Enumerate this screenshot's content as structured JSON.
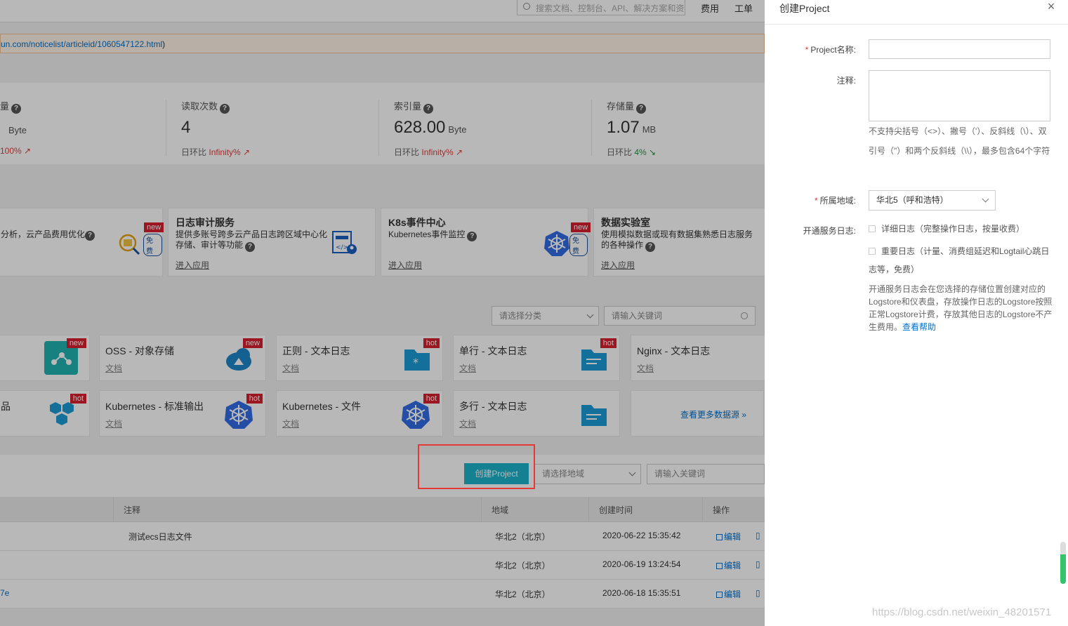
{
  "topbar": {
    "search_placeholder": "搜索文档、控制台、API、解决方案和资",
    "links": [
      "费用",
      "工单"
    ]
  },
  "notice": {
    "url_text": "un.com/noticelist/articleid/1060547122.html",
    "paren": ")"
  },
  "stats": [
    {
      "label": "量",
      "value": "",
      "unit": "Byte",
      "ratio_label": "",
      "ratio": "100%",
      "trend": "up"
    },
    {
      "label": "读取次数",
      "value": "4",
      "unit": "",
      "ratio_label": "日环比",
      "ratio": "Infinity%",
      "trend": "up"
    },
    {
      "label": "索引量",
      "value": "628.00",
      "unit": "Byte",
      "ratio_label": "日环比",
      "ratio": "Infinity%",
      "trend": "up"
    },
    {
      "label": "存储量",
      "value": "1.07",
      "unit": "MB",
      "ratio_label": "日环比",
      "ratio": "4%",
      "trend": "down"
    }
  ],
  "services": [
    {
      "title": "",
      "desc1": "分析，云产品费用优化",
      "desc2": "",
      "link": "",
      "badge": "new",
      "badge2": "免费"
    },
    {
      "title": "日志审计服务",
      "desc1": "提供多账号跨多云产品日志跨区域中心化",
      "desc2": "存储、审计等功能",
      "link": "进入应用"
    },
    {
      "title": "K8s事件中心",
      "desc1": "Kubernetes事件监控",
      "desc2": "",
      "link": "进入应用",
      "badge": "new",
      "badge2": "免费"
    },
    {
      "title": "数据实验室",
      "desc1": "使用模拟数据或现有数据集熟悉日志服务",
      "desc2": "的各种操作",
      "link": "进入应用"
    }
  ],
  "filters": {
    "category_placeholder": "请选择分类",
    "keyword_placeholder": "请输入关键词"
  },
  "datasources": {
    "row1": [
      {
        "name": "",
        "doc": "",
        "badge": "new"
      },
      {
        "name": "OSS - 对象存储",
        "doc": "文档",
        "badge": "new"
      },
      {
        "name": "正则 - 文本日志",
        "doc": "文档",
        "badge": "hot"
      },
      {
        "name": "单行 - 文本日志",
        "doc": "文档",
        "badge": "hot"
      },
      {
        "name": "Nginx - 文本日志",
        "doc": "文档",
        "badge": ""
      }
    ],
    "row2": [
      {
        "name": "品",
        "doc": "",
        "badge": "hot"
      },
      {
        "name": "Kubernetes - 标准输出",
        "doc": "文档",
        "badge": "hot"
      },
      {
        "name": "Kubernetes - 文件",
        "doc": "文档",
        "badge": "hot"
      },
      {
        "name": "多行 - 文本日志",
        "doc": "文档",
        "badge": ""
      }
    ],
    "more": "查看更多数据源 »"
  },
  "projects": {
    "create_button": "创建Project",
    "region_placeholder": "请选择地域",
    "keyword_placeholder": "请输入关键词",
    "columns": [
      "注释",
      "地域",
      "创建时间",
      "操作"
    ],
    "rows": [
      {
        "name": "",
        "note": "测试ecs日志文件",
        "region": "华北2（北京）",
        "created": "2020-06-22 15:35:42",
        "edit": "编辑"
      },
      {
        "name": "",
        "note": "",
        "region": "华北2（北京）",
        "created": "2020-06-19 13:24:54",
        "edit": "编辑"
      },
      {
        "name": "7e",
        "note": "",
        "region": "华北2（北京）",
        "created": "2020-06-18 15:35:51",
        "edit": "编辑"
      }
    ]
  },
  "drawer": {
    "title": "创建Project",
    "close": "×",
    "name_label": "Project名称:",
    "name_value": "",
    "note_label": "注释:",
    "note_value": "",
    "note_hint": "不支持尖括号（<>）、撇号（'）、反斜线（\\）、双引号（\"）和两个反斜线（\\\\），最多包含64个字符",
    "region_label": "所属地域:",
    "region_value": "华北5（呼和浩特）",
    "log_label": "开通服务日志:",
    "log_opt1": "详细日志（完整操作日志，按量收费）",
    "log_opt2": "重要日志（计量、消费组延迟和Logtail心跳日志等，免费）",
    "log_info": "开通服务日志会在您选择的存储位置创建对应的Logstore和仪表盘，存放操作日志的Logstore按照正常Logstore计费，存放其他日志的Logstore不产生费用。",
    "help_link": "查看帮助",
    "watermark": "https://blog.csdn.net/weixin_48201571"
  },
  "colors": {
    "accent": "#1bb3c9",
    "link": "#0070cc",
    "danger": "#e53935",
    "hot_badge": "#d81f2f"
  }
}
